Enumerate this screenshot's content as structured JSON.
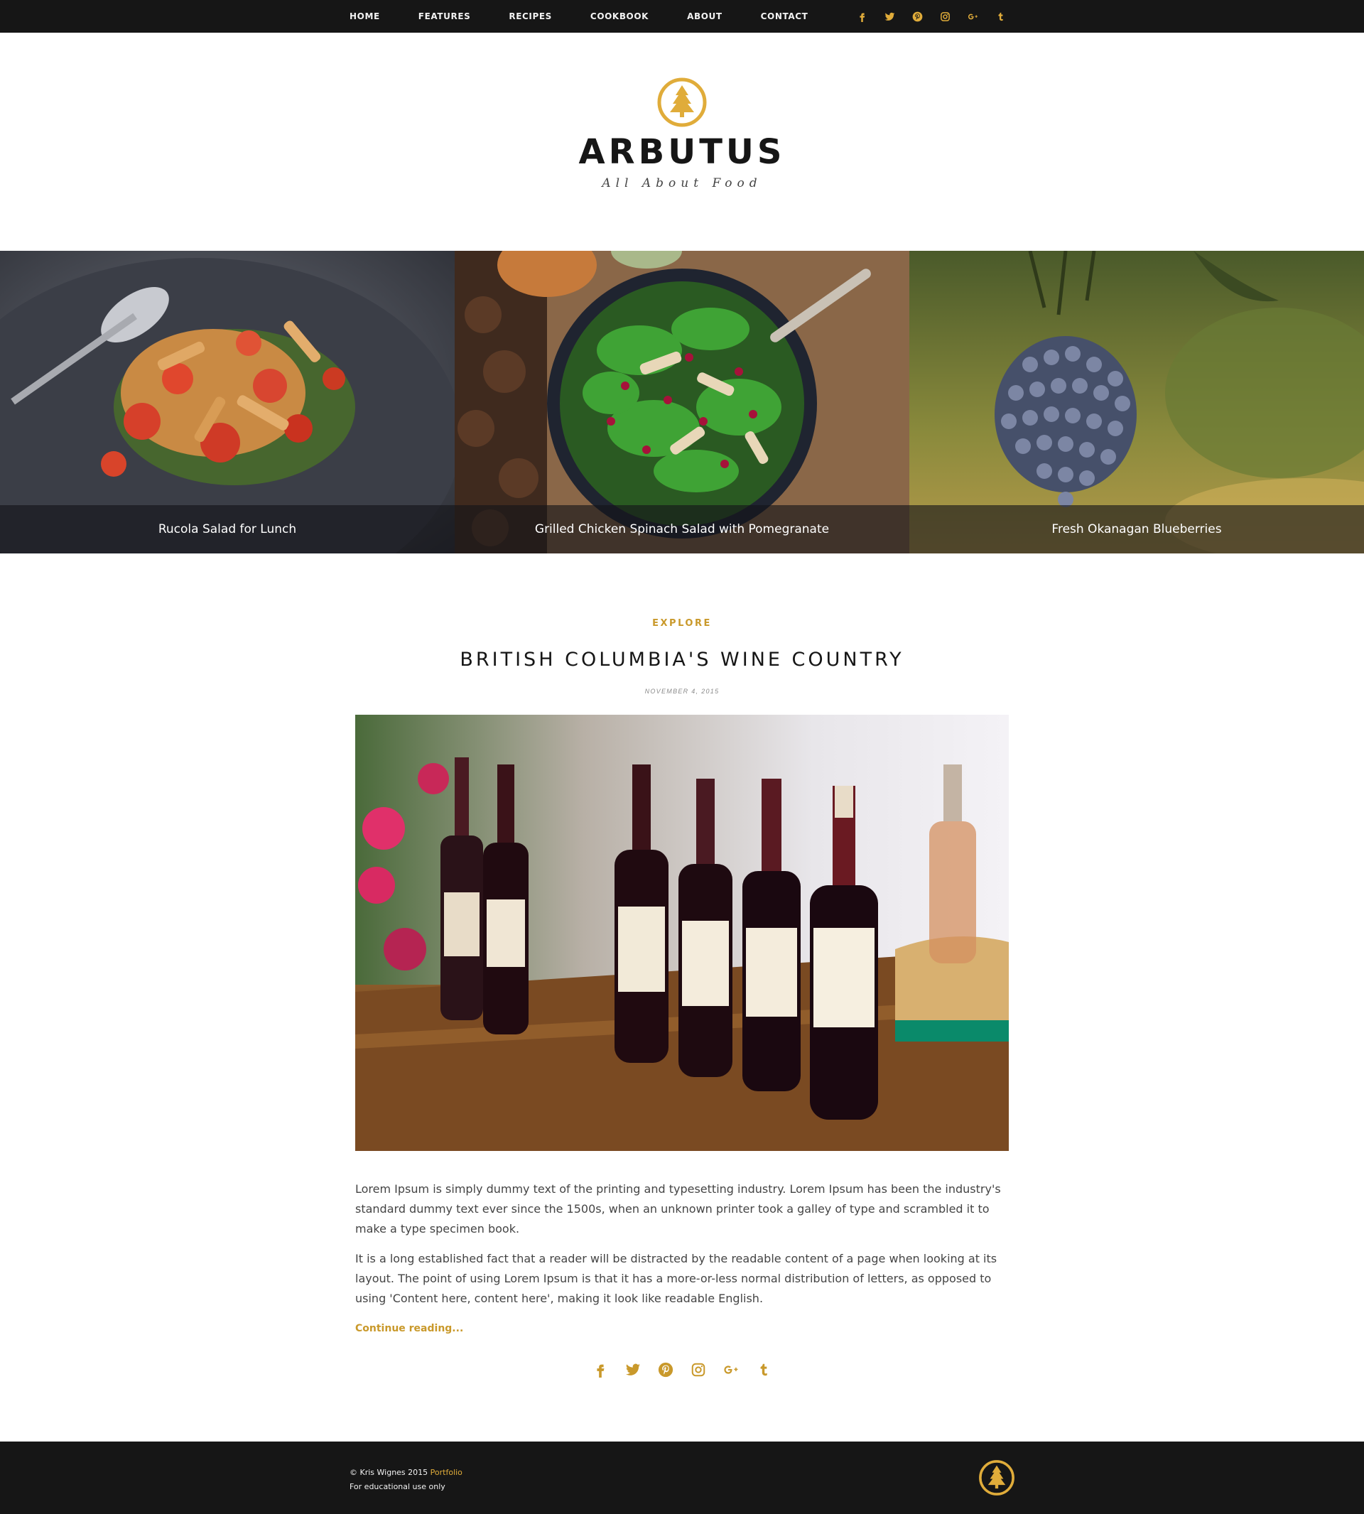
{
  "colors": {
    "accent": "#c9992b",
    "dark": "#161616",
    "logo": "#e0ac3a"
  },
  "nav": {
    "items": [
      "HOME",
      "FEATURES",
      "RECIPES",
      "COOKBOOK",
      "ABOUT",
      "CONTACT"
    ],
    "social": [
      "facebook-icon",
      "twitter-icon",
      "pinterest-icon",
      "instagram-icon",
      "google-plus-icon",
      "tumblr-icon"
    ]
  },
  "brand": {
    "title": "ARBUTUS",
    "tagline": "All About Food",
    "logo_icon": "tree-icon"
  },
  "featured": [
    {
      "caption": "Rucola Salad for Lunch"
    },
    {
      "caption": "Grilled Chicken Spinach Salad with Pomegranate"
    },
    {
      "caption": "Fresh Okanagan Blueberries"
    }
  ],
  "post": {
    "category": "EXPLORE",
    "title": "BRITISH COLUMBIA'S WINE COUNTRY",
    "date": "NOVEMBER 4, 2015",
    "paragraphs": [
      "Lorem Ipsum is simply dummy text of the printing and typesetting industry. Lorem Ipsum has been the industry's standard dummy text ever since the 1500s, when an unknown printer took a galley of type and scrambled it to make a type specimen book.",
      "It is a long established fact that a reader will be distracted by the readable content of a page when looking at its layout. The point of using Lorem Ipsum is that it has a more-or-less normal distribution of letters, as opposed to using 'Content here, content here', making it look like readable English."
    ],
    "continue_label": "Continue reading..."
  },
  "footer": {
    "copyright": "© Kris Wignes 2015",
    "portfolio_label": "Portfolio",
    "note": "For educational use only"
  }
}
